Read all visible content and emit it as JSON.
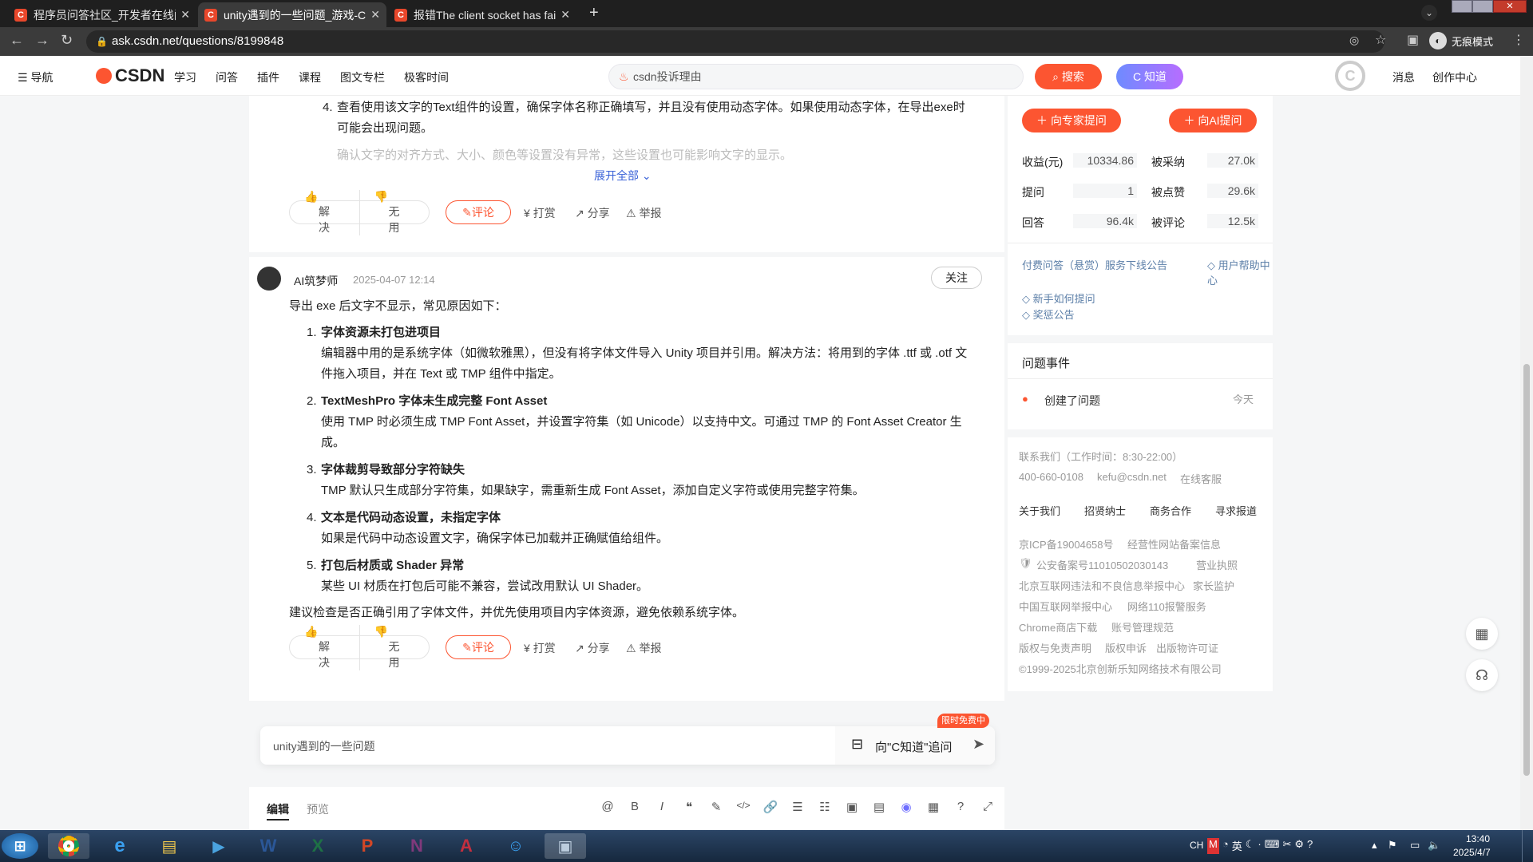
{
  "browser": {
    "tabs": [
      {
        "label": "程序员问答社区_开发者在线问题",
        "fav": "C"
      },
      {
        "label": "unity遇到的一些问题_游戏-CSDN",
        "fav": "C"
      },
      {
        "label": "报错The client socket has failed",
        "fav": "C"
      }
    ],
    "new_tab": "+",
    "url": "ask.csdn.net/questions/8199848",
    "incognito": "无痕模式"
  },
  "header": {
    "menu": "导航",
    "logo": "CSDN",
    "nav": [
      "学习",
      "问答",
      "插件",
      "课程",
      "图文专栏",
      "极客时间"
    ],
    "search_placeholder": "csdn投诉理由",
    "search_btn": "搜索",
    "zhidao_btn": "C 知道",
    "messages": "消息",
    "creator": "创作中心"
  },
  "answer1": {
    "item4_num": "4.",
    "item4": "查看使用该文字的Text组件的设置，确保字体名称正确填写，并且没有使用动态字体。如果使用动态字体，在导出exe时可能会出现问题。",
    "item5_num": "5.",
    "item5": "确认文字的对齐方式、大小、颜色等设置没有异常，这些设置也可能影响文字的显示。",
    "expand": "展开全部",
    "solve": "解决",
    "useless": "无用",
    "comment": "评论",
    "reward": "打赏",
    "share": "分享",
    "report": "举报"
  },
  "answer2": {
    "author": "AI筑梦师",
    "time": "2025-04-07 12:14",
    "follow": "关注",
    "intro": "导出 exe 后文字不显示，常见原因如下：",
    "items": [
      {
        "num": "1.",
        "title": "字体资源未打包进项目",
        "body": "编辑器中用的是系统字体（如微软雅黑），但没有将字体文件导入 Unity 项目并引用。解决方法：将用到的字体 .ttf 或 .otf 文件拖入项目，并在 Text 或 TMP 组件中指定。"
      },
      {
        "num": "2.",
        "title": "TextMeshPro 字体未生成完整 Font Asset",
        "body": "使用 TMP 时必须生成 TMP Font Asset，并设置字符集（如 Unicode）以支持中文。可通过 TMP 的 Font Asset Creator 生成。"
      },
      {
        "num": "3.",
        "title": "字体裁剪导致部分字符缺失",
        "body": "TMP 默认只生成部分字符集，如果缺字，需重新生成 Font Asset，添加自定义字符或使用完整字符集。"
      },
      {
        "num": "4.",
        "title": "文本是代码动态设置，未指定字体",
        "body": "如果是代码中动态设置文字，确保字体已加载并正确赋值给组件。"
      },
      {
        "num": "5.",
        "title": "打包后材质或 Shader 异常",
        "body": "某些 UI 材质在打包后可能不兼容，尝试改用默认 UI Shader。"
      }
    ],
    "conclusion": "建议检查是否正确引用了字体文件，并优先使用项目内字体资源，避免依赖系统字体。",
    "solve": "解决",
    "useless": "无用",
    "comment": "评论",
    "reward": "打赏",
    "share": "分享",
    "report": "举报"
  },
  "ask_bar": {
    "text": "unity遇到的一些问题",
    "badge": "限时免费中",
    "button": "向\"C知道\"追问"
  },
  "editor": {
    "tab_edit": "编辑",
    "tab_preview": "预览",
    "tools": [
      "@",
      "B",
      "I",
      "❝",
      "✎",
      "</>",
      "🔗",
      "☰",
      "☷",
      "▣",
      "▤",
      "◉",
      "▦",
      "?",
      "⤢"
    ]
  },
  "sidebar": {
    "ask_expert": "向专家提问",
    "ask_ai": "向AI提问",
    "stats": [
      {
        "label": "收益(元)",
        "value": "10334.86",
        "label2": "被采纳",
        "value2": "27.0k"
      },
      {
        "label": "提问",
        "value": "1",
        "label2": "被点赞",
        "value2": "29.6k"
      },
      {
        "label": "回答",
        "value": "96.4k",
        "label2": "被评论",
        "value2": "12.5k"
      }
    ],
    "links": {
      "l1": "付费问答（悬赏）服务下线公告",
      "l2": "◇ 用户帮助中心",
      "l3": "◇ 新手如何提问",
      "l4": "◇ 奖惩公告"
    },
    "events_title": "问题事件",
    "event_text": "创建了问题",
    "event_time": "今天",
    "footer": {
      "contact": "联系我们（工作时间：8:30-22:00）",
      "phone": "400-660-0108",
      "email": "kefu@csdn.net",
      "service": "在线客服",
      "about": [
        "关于我们",
        "招贤纳士",
        "商务合作",
        "寻求报道"
      ],
      "icp": "京ICP备19004658号",
      "icp2": "经营性网站备案信息",
      "police": "公安备案号11010502030143",
      "license": "营业执照",
      "report1": "北京互联网违法和不良信息举报中心",
      "guard": "家长监护",
      "report2": "中国互联网举报中心",
      "police110": "网络110报警服务",
      "chrome": "Chrome商店下载",
      "account": "账号管理规范",
      "copyright": "版权与免责声明",
      "appeal": "版权申诉",
      "publish": "出版物许可证",
      "company": "©1999-2025北京创新乐知网络技术有限公司"
    }
  },
  "taskbar": {
    "ime": "CH",
    "time": "13:40",
    "date": "2025/4/7"
  }
}
